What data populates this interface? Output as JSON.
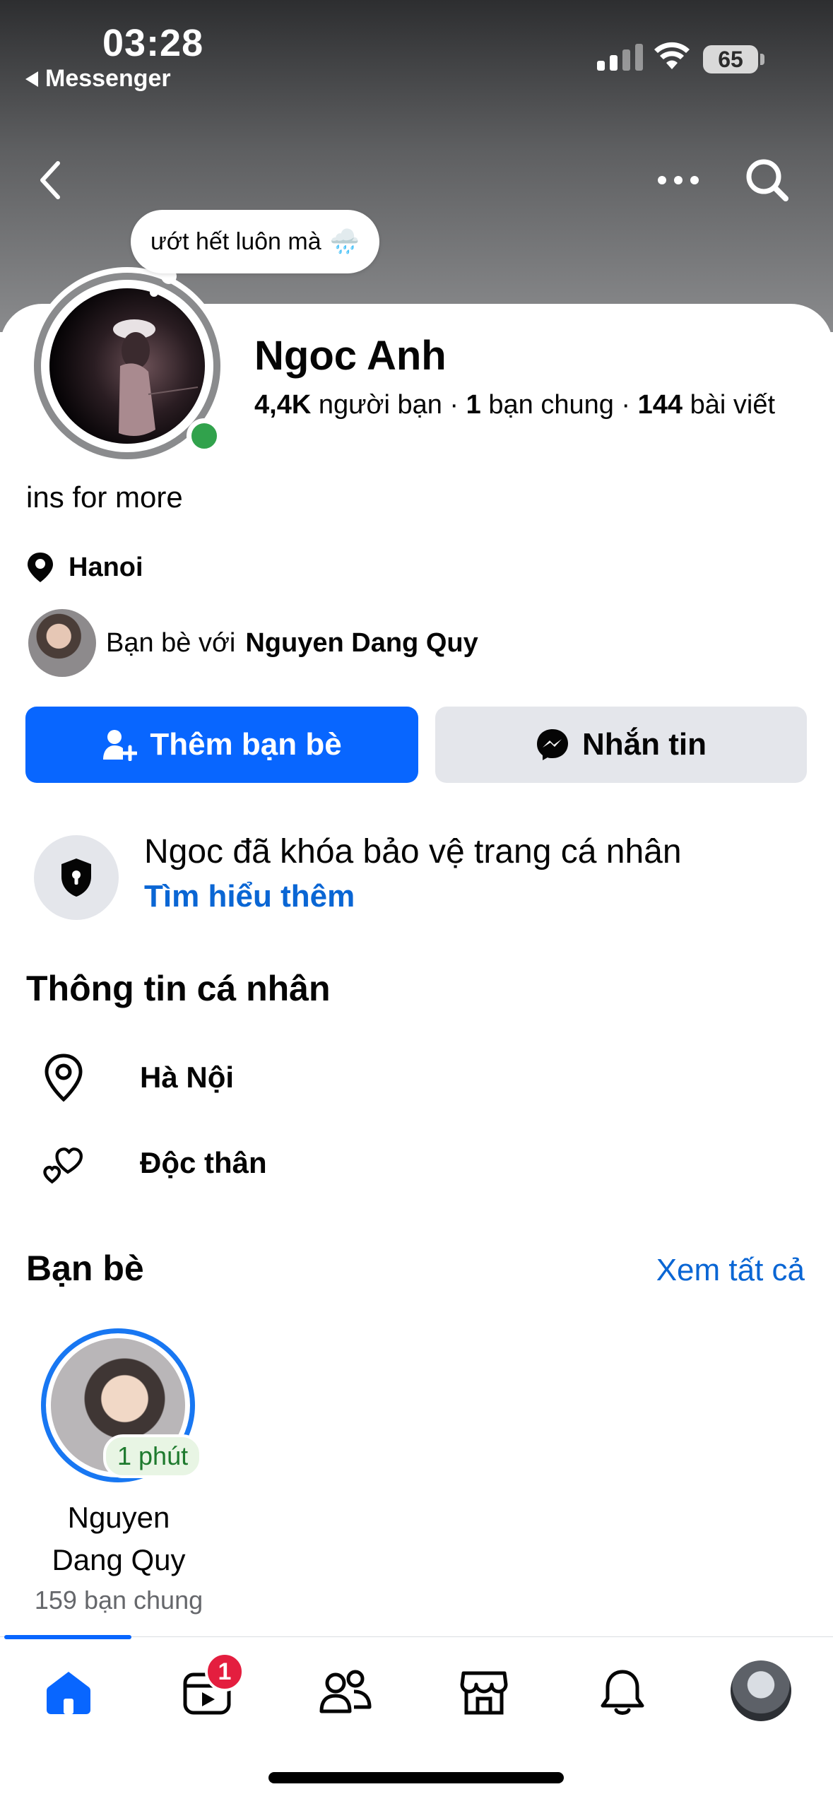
{
  "status_bar": {
    "time": "03:28",
    "back_app": "Messenger",
    "battery": "65"
  },
  "note": {
    "text": "ướt hết luôn mà",
    "emoji": "🌧️"
  },
  "profile": {
    "name": "Ngoc Anh",
    "friends_count": "4,4K",
    "friends_label": "người bạn",
    "mutual_count": "1",
    "mutual_label": "bạn chung",
    "posts_count": "144",
    "posts_label": "bài viết",
    "bio": "ins for more",
    "location": "Hanoi",
    "friend_with_prefix": "Bạn bè với",
    "friend_with_name": "Nguyen Dang Quy"
  },
  "actions": {
    "add_friend": "Thêm bạn bè",
    "message": "Nhắn tin"
  },
  "lock_notice": {
    "title": "Ngoc đã khóa bảo vệ trang cá nhân",
    "link": "Tìm hiểu thêm"
  },
  "personal_info": {
    "title": "Thông tin cá nhân",
    "city": "Hà Nội",
    "relationship": "Độc thân"
  },
  "friends_section": {
    "title": "Bạn bè",
    "see_all": "Xem tất cả",
    "friend": {
      "name": "Nguyen Dang Quy",
      "badge": "1 phút",
      "mutual": "159 bạn chung"
    }
  },
  "tabbar": {
    "video_badge": "1"
  },
  "colors": {
    "accent": "#0866ff",
    "link": "#0a66d4",
    "online": "#31a24c",
    "badge": "#e41e3f"
  },
  "icons": [
    "chevron-left-icon",
    "more-icon",
    "search-icon",
    "location-pin-icon",
    "add-friend-icon",
    "messenger-icon",
    "shield-lock-icon",
    "hearts-icon",
    "home-icon",
    "video-icon",
    "friends-icon",
    "marketplace-icon",
    "bell-icon"
  ]
}
